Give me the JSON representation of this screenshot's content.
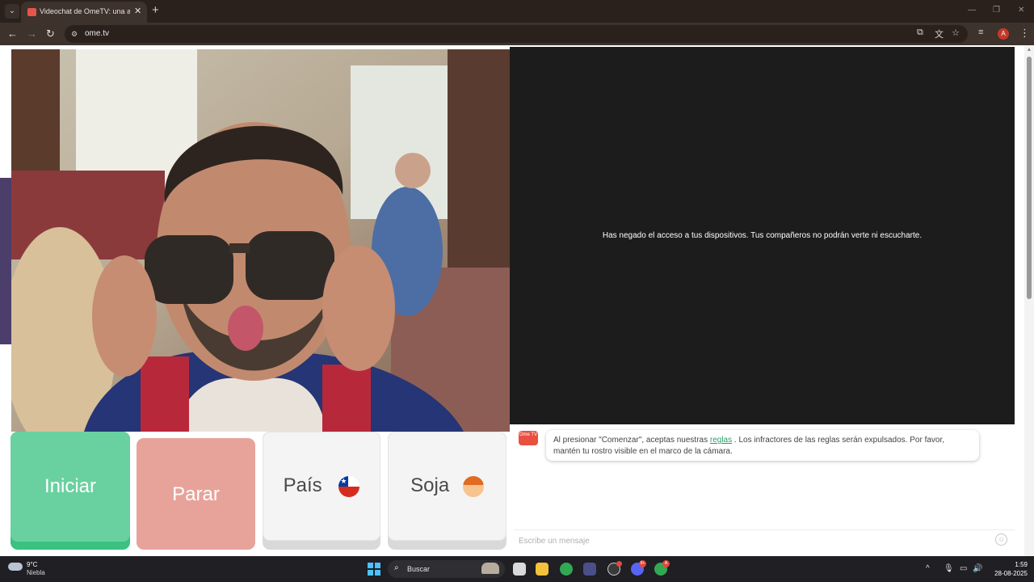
{
  "browser": {
    "tab_title": "Videochat de OmeTV: una alternativa",
    "url": "ome.tv",
    "profile_initial": "A"
  },
  "page": {
    "remote_message": "Has negado el acceso a tus dispositivos. Tus compañeros no podrán verte ni escucharte."
  },
  "buttons": {
    "start": "Iniciar",
    "stop": "Parar",
    "country": "País",
    "gender": "Soja"
  },
  "chat": {
    "logo": "Ome TV",
    "message_before": "Al presionar \"Comenzar\", aceptas nuestras ",
    "message_link": "reglas",
    "message_after": " . Los infractores de las reglas serán expulsados. Por favor, mantén tu rostro visible en el marco de la cámara.",
    "input_placeholder": "Escribe un mensaje"
  },
  "taskbar": {
    "temperature": "9°C",
    "weather": "Niebla",
    "search": "Buscar",
    "time": "1:59",
    "date": "28-08-2025",
    "discord_badge": "9+",
    "chrome_badge": "A"
  },
  "colors": {
    "start_button": "#69d1a0",
    "stop_button": "#e7a39a",
    "link": "#2a9d6a"
  }
}
